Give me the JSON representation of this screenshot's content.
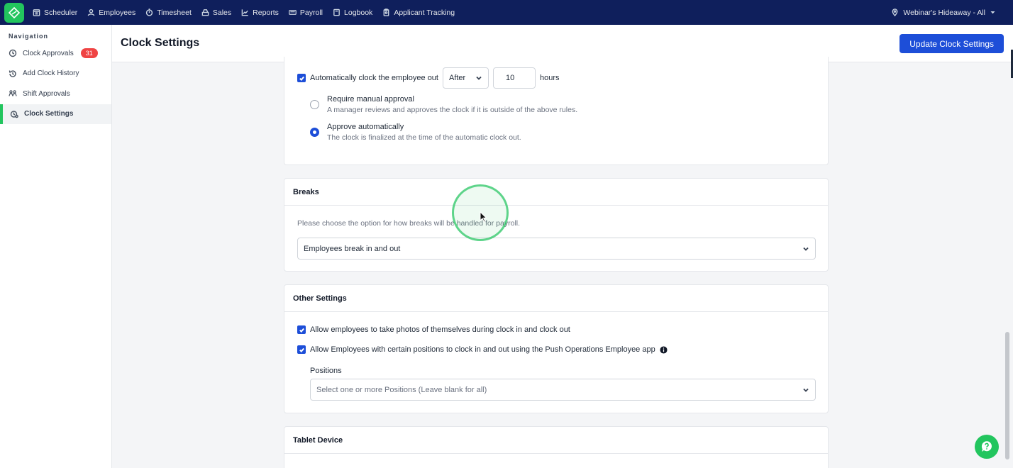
{
  "topnav": {
    "items": [
      {
        "label": "Scheduler",
        "icon": "calendar-icon"
      },
      {
        "label": "Employees",
        "icon": "user-icon"
      },
      {
        "label": "Timesheet",
        "icon": "clock-icon"
      },
      {
        "label": "Sales",
        "icon": "stack-icon"
      },
      {
        "label": "Reports",
        "icon": "chart-icon"
      },
      {
        "label": "Payroll",
        "icon": "money-icon"
      },
      {
        "label": "Logbook",
        "icon": "book-icon"
      },
      {
        "label": "Applicant Tracking",
        "icon": "clipboard-icon"
      }
    ],
    "location": "Webinar's Hideaway - All"
  },
  "sidebar": {
    "title": "Navigation",
    "items": [
      {
        "label": "Clock Approvals",
        "badge": "31"
      },
      {
        "label": "Add Clock History"
      },
      {
        "label": "Shift Approvals"
      },
      {
        "label": "Clock Settings"
      }
    ]
  },
  "header": {
    "title": "Clock Settings",
    "update_label": "Update Clock Settings"
  },
  "auto_clock": {
    "checkbox_label": "Automatically clock the employee out",
    "after_select": "After",
    "hours_value": "10",
    "hours_unit": "hours",
    "manual": {
      "label": "Require manual approval",
      "desc": "A manager reviews and approves the clock if it is outside of the above rules."
    },
    "automatic": {
      "label": "Approve automatically",
      "desc": "The clock is finalized at the time of the automatic clock out."
    }
  },
  "breaks": {
    "title": "Breaks",
    "description": "Please choose the option for how breaks will be handled for payroll.",
    "selected": "Employees break in and out"
  },
  "other_settings": {
    "title": "Other Settings",
    "photos_label": "Allow employees to take photos of themselves during clock in and clock out",
    "positions_label": "Allow Employees with certain positions to clock in and out using the Push Operations Employee app",
    "positions_field_label": "Positions",
    "positions_placeholder": "Select one or more Positions (Leave blank for all)"
  },
  "tablet": {
    "title": "Tablet Device"
  },
  "colors": {
    "nav_bg": "#0f1f5c",
    "accent": "#1d4ed8",
    "brand": "#22c55e",
    "badge": "#ef4444"
  }
}
